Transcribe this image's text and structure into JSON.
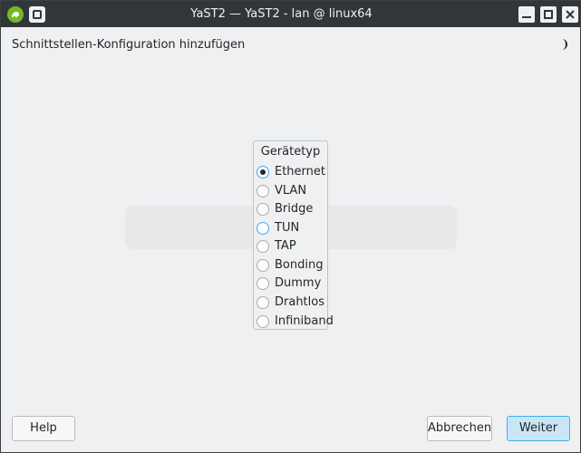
{
  "window": {
    "title": "YaST2 — YaST2 - lan @ linux64"
  },
  "dialog": {
    "heading": "Schnittstellen-Konfiguration hinzufügen"
  },
  "device_type": {
    "title": "Gerätetyp",
    "options": [
      {
        "label": "Ethernet",
        "checked": true
      },
      {
        "label": "VLAN",
        "checked": false
      },
      {
        "label": "Bridge",
        "checked": false
      },
      {
        "label": "TUN",
        "checked": false
      },
      {
        "label": "TAP",
        "checked": false
      },
      {
        "label": "Bonding",
        "checked": false
      },
      {
        "label": "Dummy",
        "checked": false
      },
      {
        "label": "Drahtlos",
        "checked": false
      },
      {
        "label": "Infiniband",
        "checked": false
      }
    ]
  },
  "buttons": {
    "help": "Help",
    "cancel": "Abbrechen",
    "next": "Weiter"
  },
  "colors": {
    "accent": "#3daee9",
    "titlebar": "#31363b",
    "background": "#eff0f1"
  },
  "icons": {
    "app": "opensuse-chameleon-icon",
    "pin": "keep-on-top-icon",
    "theme": "moon-icon"
  }
}
